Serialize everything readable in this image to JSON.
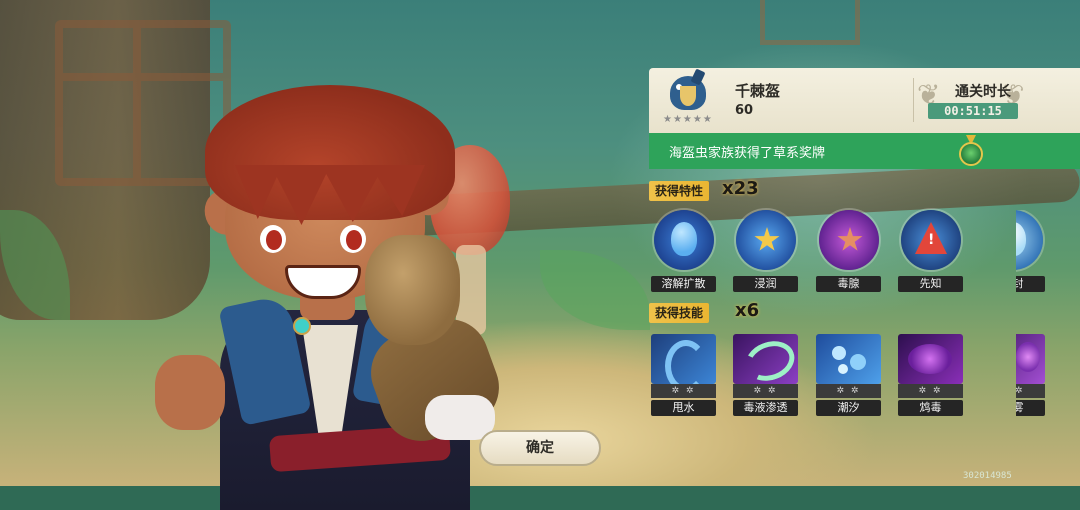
{
  "result": {
    "boss_name": "千棘盔",
    "boss_level": "60",
    "stars": "★★★★★",
    "clear_label": "通关时长",
    "clear_time": "00:51:15"
  },
  "medal": {
    "text": "海盔虫家族获得了草系奖牌",
    "icon": "grass-medal-icon"
  },
  "traits": {
    "title": "获得特性",
    "count": "x23",
    "items": [
      {
        "label": "溶解扩散",
        "icon": "blue-egg-icon"
      },
      {
        "label": "浸润",
        "icon": "blue-star-swirl-icon"
      },
      {
        "label": "毒腺",
        "icon": "purple-star-icon"
      },
      {
        "label": "先知",
        "icon": "warning-triangle-icon"
      },
      {
        "label": "冰封",
        "icon": "ice-icon"
      }
    ]
  },
  "skills": {
    "title": "获得技能",
    "count": "x6",
    "items": [
      {
        "label": "甩水",
        "meta": "✲ ✲",
        "icon": "water-whip-icon"
      },
      {
        "label": "毒液渗透",
        "meta": "✲ ✲",
        "icon": "venom-seep-icon"
      },
      {
        "label": "潮汐",
        "meta": "✲ ✲",
        "icon": "tide-icon"
      },
      {
        "label": "鸩毒",
        "meta": "✲ ✲",
        "icon": "poison-burst-icon"
      },
      {
        "label": "毒雾",
        "meta": "✲ ✲",
        "icon": "poison-mist-icon"
      }
    ]
  },
  "confirm_label": "确定",
  "build_id": "302014985",
  "colors": {
    "panel_green": "#2ea35a",
    "tag_gold": "#f0c24a",
    "time_bg": "#4a9a7b"
  }
}
